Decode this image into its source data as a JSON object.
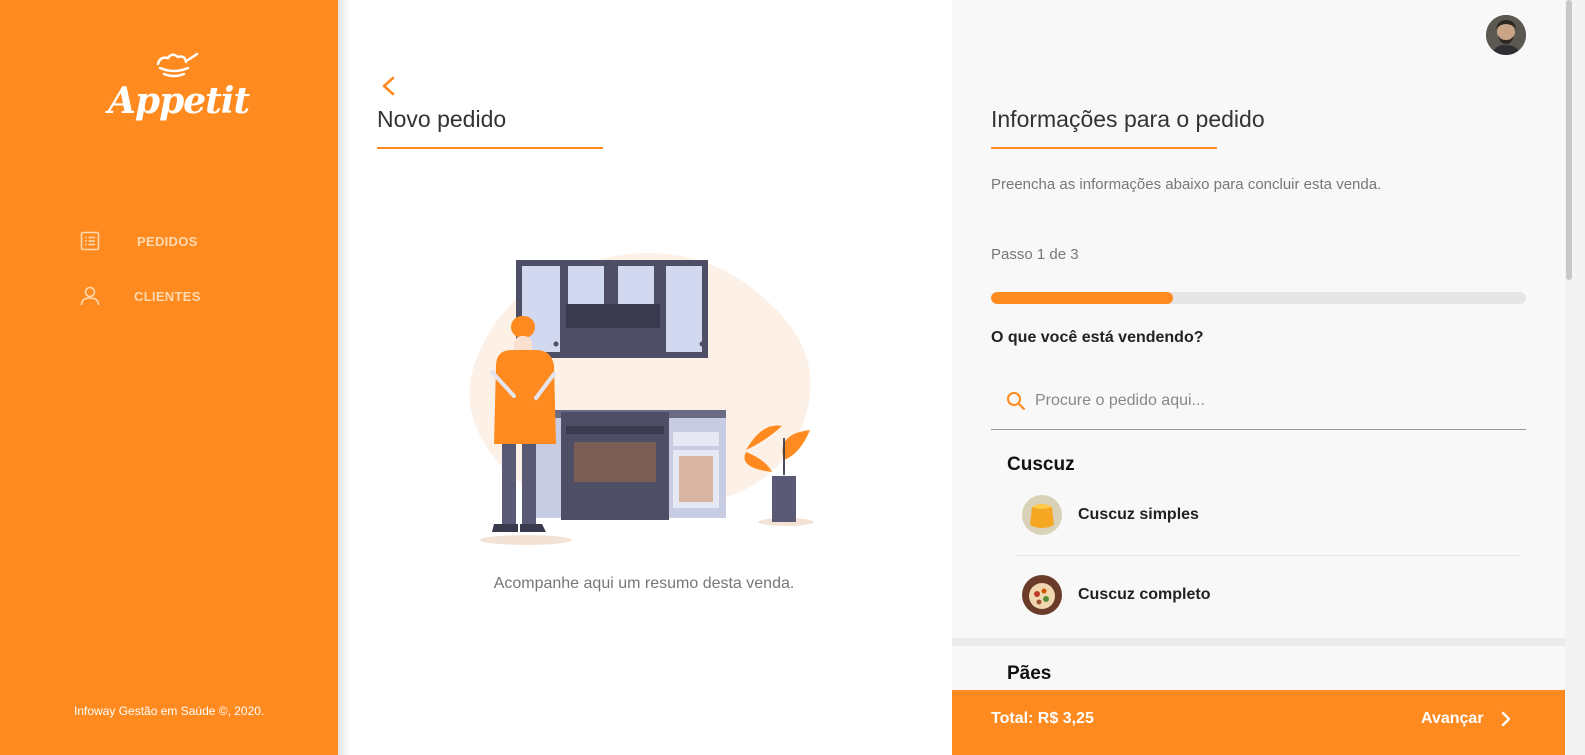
{
  "app": {
    "brand": "Appetit",
    "accent_color": "#ff8a1f"
  },
  "sidebar": {
    "items": [
      {
        "label": "PEDIDOS",
        "icon": "list-icon"
      },
      {
        "label": "CLIENTES",
        "icon": "user-icon"
      }
    ],
    "footer": "Infoway Gestão em Saúde ©, 2020."
  },
  "main": {
    "title": "Novo pedido",
    "caption": "Acompanhe aqui um resumo desta venda."
  },
  "order_panel": {
    "title": "Informações para o pedido",
    "description": "Preencha as informações abaixo para concluir esta venda.",
    "step_text": "Passo 1 de 3",
    "progress_fraction": 0.34,
    "question": "O que você está vendendo?",
    "search": {
      "placeholder": "Procure o pedido aqui...",
      "value": ""
    },
    "categories": [
      {
        "name": "Cuscuz",
        "items": [
          {
            "label": "Cuscuz simples"
          },
          {
            "label": "Cuscuz completo"
          }
        ]
      },
      {
        "name": "Pães",
        "items": []
      }
    ]
  },
  "footer_bar": {
    "total": "Total: R$ 3,25",
    "advance_label": "Avançar"
  }
}
